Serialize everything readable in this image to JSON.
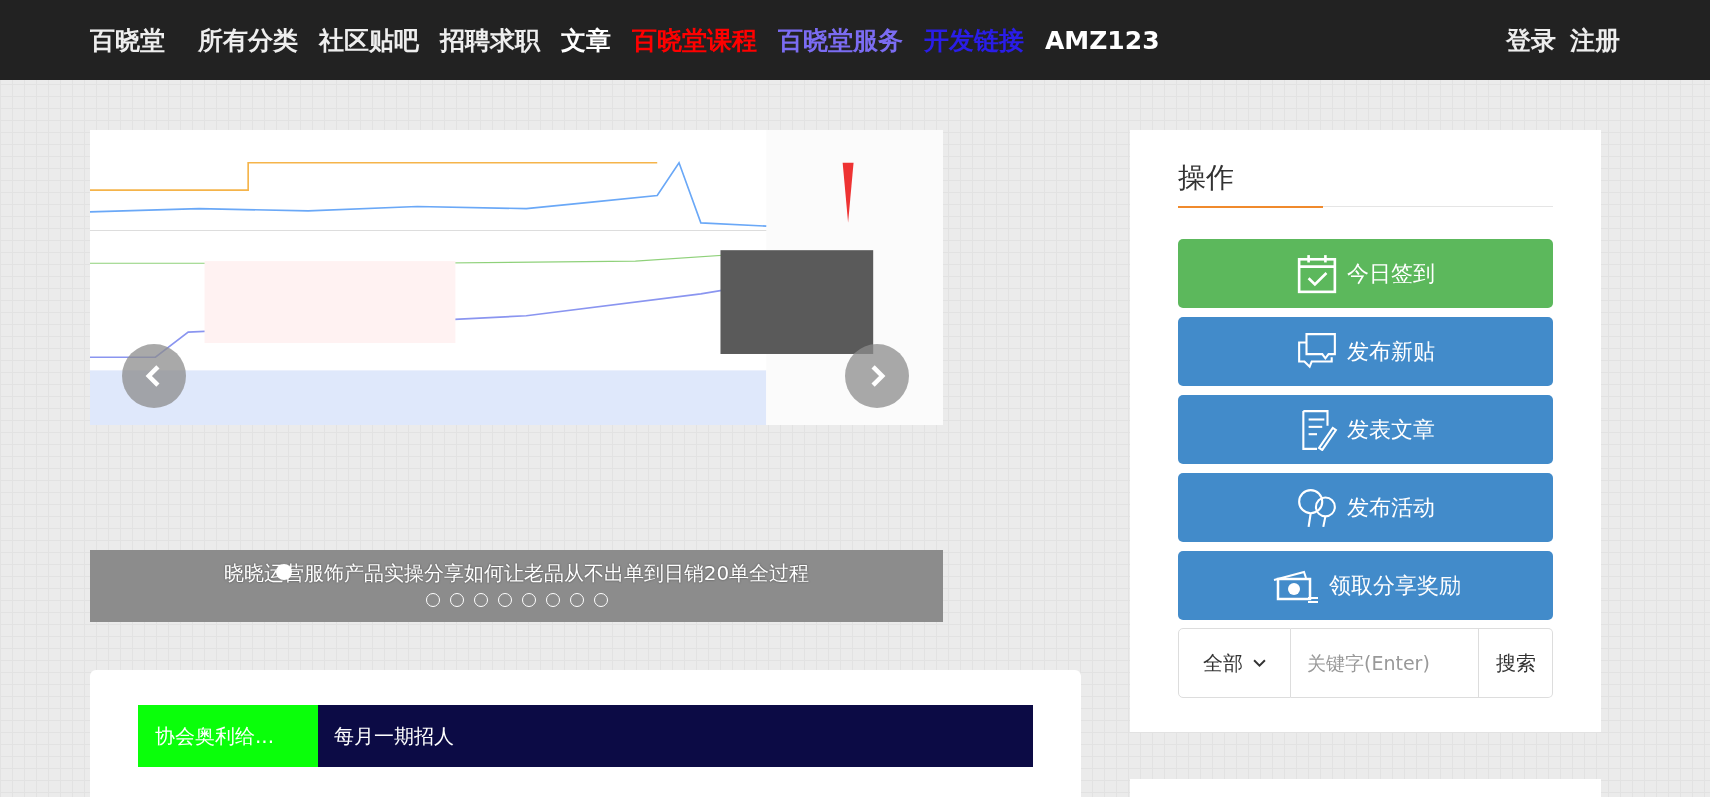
{
  "nav": {
    "brand": "百晓堂",
    "items": [
      {
        "label": "所有分类",
        "color": "#eeeeee"
      },
      {
        "label": "社区贴吧",
        "color": "#eeeeee"
      },
      {
        "label": "招聘求职",
        "color": "#eeeeee"
      },
      {
        "label": "文章",
        "color": "#ffffff"
      },
      {
        "label": "百晓堂课程",
        "color": "#ff0000"
      },
      {
        "label": "百晓堂服务",
        "color": "#7b6cf2"
      },
      {
        "label": "开发链接",
        "color": "#2a1de8"
      },
      {
        "label": "AMZ123",
        "color": "#ffffff"
      }
    ],
    "auth": [
      "登录",
      "注册"
    ]
  },
  "carousel": {
    "caption": "晓晓运营服饰产品实操分享如何让老品从不出单到日销20单全过程",
    "current_marker": true,
    "indicators": [
      {
        "selected": false
      },
      {
        "selected": false
      },
      {
        "selected": false
      },
      {
        "selected": false
      },
      {
        "selected": false
      },
      {
        "selected": false
      },
      {
        "selected": false
      },
      {
        "selected": false
      }
    ]
  },
  "notice": {
    "tag": "协会奥利给...",
    "text": "每月一期招人"
  },
  "actions": {
    "title": "操作",
    "buttons": [
      {
        "label": "今日签到",
        "kind": "calendar",
        "color": "#5cb85c"
      },
      {
        "label": "发布新贴",
        "kind": "chat",
        "color": "#428bca"
      },
      {
        "label": "发表文章",
        "kind": "document",
        "color": "#428bca"
      },
      {
        "label": "发布活动",
        "kind": "balloons",
        "color": "#428bca"
      },
      {
        "label": "领取分享奖励",
        "kind": "money",
        "color": "#428bca"
      }
    ],
    "search": {
      "scope": "全部",
      "placeholder": "关键字(Enter)",
      "button": "搜索"
    }
  }
}
